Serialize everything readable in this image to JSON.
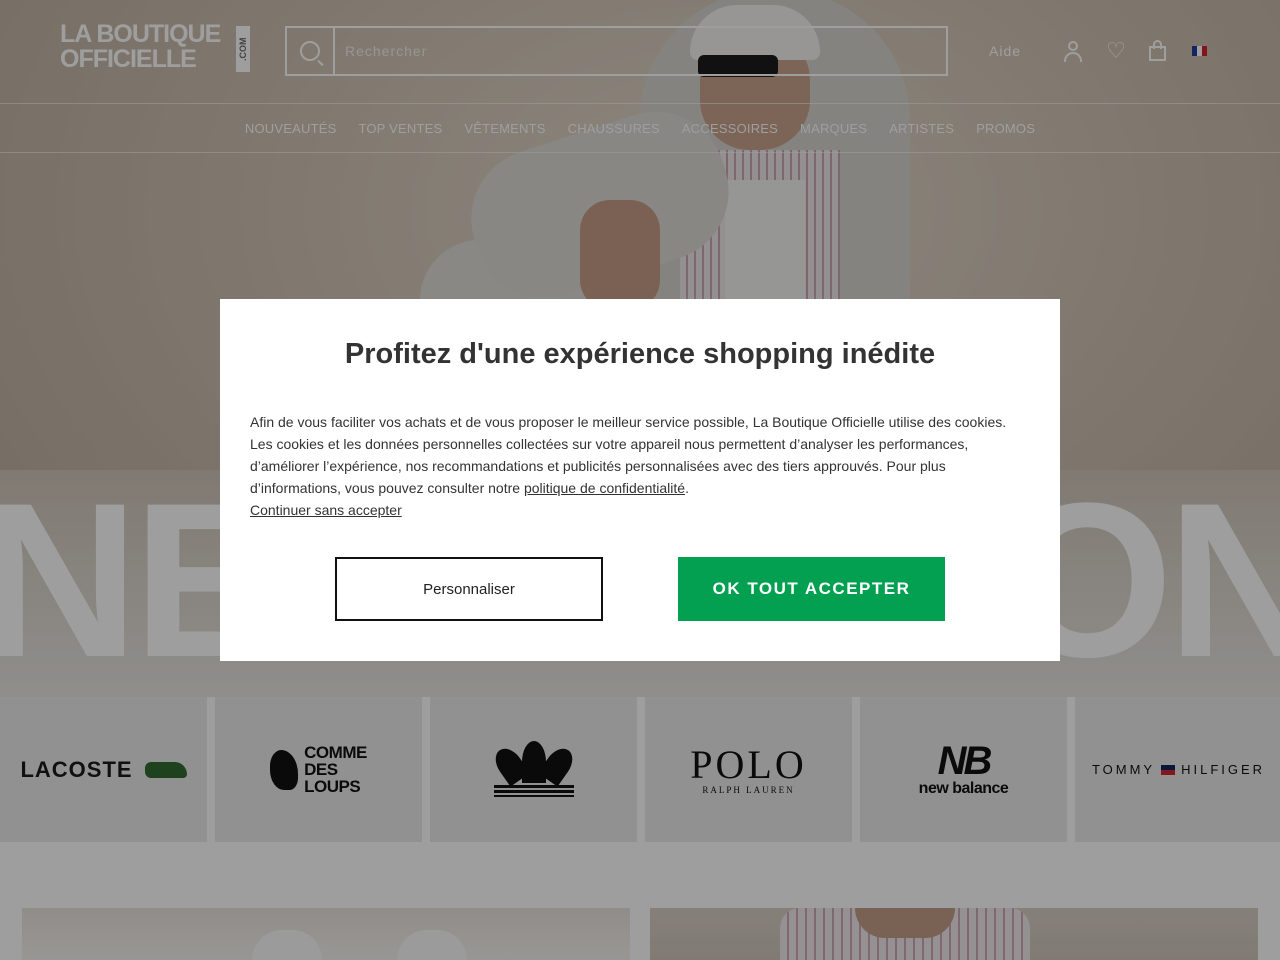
{
  "header": {
    "logo_line1": "LA BOUTIQUE",
    "logo_line2": "OFFICIELLE",
    "logo_suffix": ".COM",
    "search_placeholder": "Rechercher",
    "help_label": "Aide",
    "icons": [
      "search-icon",
      "user-icon",
      "heart-icon",
      "bag-icon",
      "flag-fr-icon"
    ]
  },
  "nav": {
    "items": [
      "NOUVEAUTÉS",
      "TOP VENTES",
      "VÊTEMENTS",
      "CHAUSSURES",
      "ACCESSOIRES",
      "MARQUES",
      "ARTISTES",
      "PROMOS"
    ]
  },
  "hero": {
    "big_text_left": "NE",
    "big_text_right": "ON"
  },
  "brands": {
    "lacoste": "LACOSTE",
    "comme_des_loups": [
      "COMME",
      "DES",
      "LOUPS"
    ],
    "polo_main": "POLO",
    "polo_sub": "RALPH LAUREN",
    "new_balance_mark": "NB",
    "new_balance_word": "new balance",
    "tommy_left": "TOMMY",
    "tommy_right": "HILFIGER"
  },
  "consent": {
    "title": "Profitez d'une expérience shopping inédite",
    "body": "Afin de vous faciliter vos achats et de vous proposer le meilleur service possible, La Boutique Officielle utilise des cookies. Les cookies et les données personnelles collectées sur votre appareil nous permettent d’analyser les performances, d’améliorer l’expérience, nos recommandations et publicités personnalisées avec des tiers approuvés. Pour plus d’informations, vous pouvez consulter notre ",
    "privacy_link": "politique de confidentialité",
    "after_link": ".",
    "continue_link": "Continuer sans accepter",
    "customize_button": "Personnaliser",
    "accept_button": "OK TOUT ACCEPTER"
  },
  "colors": {
    "accept_green": "#03a052",
    "text_dark": "#333333",
    "overlay": "rgba(0,0,0,0.38)"
  }
}
